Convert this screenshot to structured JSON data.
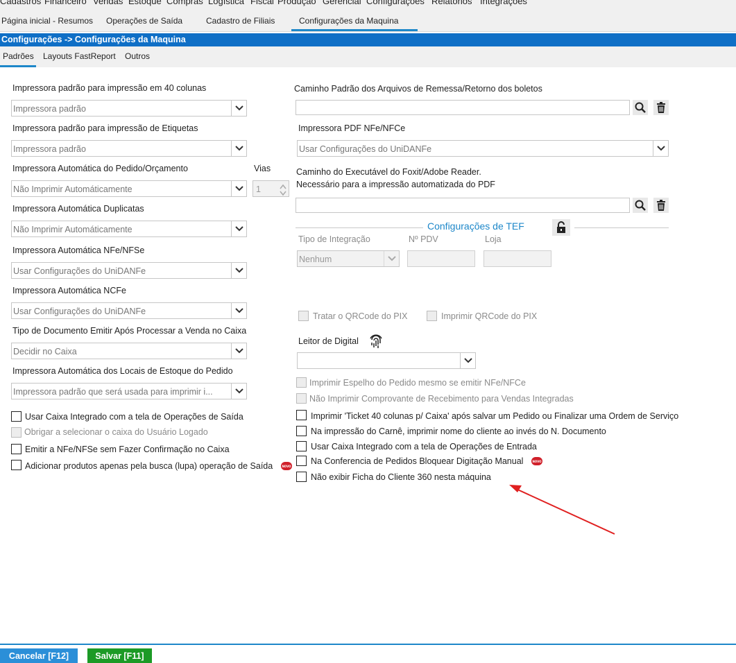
{
  "menu": [
    "Cadastros",
    "Financeiro",
    "Vendas",
    "Estoque",
    "Compras",
    "Logística",
    "Fiscal",
    "Produção",
    "Gerencial",
    "Configurações",
    "Relatórios",
    "Integrações"
  ],
  "tabs": [
    "Página inicial - Resumos",
    "Operações de Saída",
    "Cadastro de Filiais",
    "Configurações da Maquina"
  ],
  "breadcrumb": "Configurações -> Configurações da Maquina",
  "subtabs": [
    "Padrões",
    "Layouts FastReport",
    "Outros"
  ],
  "left": {
    "printer40_label": "Impressora padrão para impressão em 40 colunas",
    "printer40_value": "Impressora padrão",
    "labels_printer_label": "Impressora padrão para impressão de Etiquetas",
    "labels_printer_value": "Impressora padrão",
    "auto_order_label": "Impressora Automática do Pedido/Orçamento",
    "auto_order_value": "Não Imprimir Automáticamente",
    "copies_label": "Vias",
    "copies_value": "1",
    "auto_dup_label": "Impressora Automática Duplicatas",
    "auto_dup_value": "Não Imprimir Automáticamente",
    "auto_nfe_label": "Impressora Automática NFe/NFSe",
    "auto_nfe_value": "Usar Configurações do UniDANFe",
    "auto_ncfe_label": "Impressora Automática NCFe",
    "auto_ncfe_value": "Usar Configurações do UniDANFe",
    "doc_type_label": "Tipo de Documento Emitir Após Processar a Venda no Caixa",
    "doc_type_value": "Decidir no Caixa",
    "stock_print_label": "Impressora Automática dos Locais de Estoque do Pedido",
    "stock_print_value": "Impressora padrão que será usada para imprimir i...",
    "chk_integrated_cash": "Usar Caixa Integrado com a tela de Operações de Saída",
    "chk_force_user_cash": "Obrigar a selecionar o caixa do Usuário Logado",
    "chk_emit_nfe": "Emitir a NFe/NFSe sem Fazer Confirmação no Caixa",
    "chk_add_products": "Adicionar produtos apenas pela busca (lupa) operação de Saída"
  },
  "right": {
    "remessa_label": "Caminho Padrão dos Arquivos de Remessa/Retorno dos boletos",
    "pdf_printer_label": "Impressora PDF NFe/NFCe",
    "pdf_printer_value": "Usar Configurações do UniDANFe",
    "foxit_label_1": "Caminho do Executável do Foxit/Adobe Reader.",
    "foxit_label_2": "Necessário para a impressão automatizada do PDF",
    "tef_title": "Configurações de TEF",
    "tef_integration_label": "Tipo de Integração",
    "tef_integration_value": "Nenhum",
    "tef_pdv_label": "Nº PDV",
    "tef_store_label": "Loja",
    "chk_qrcode_pix": "Tratar o QRCode do PIX",
    "chk_print_qrcode": "Imprimir QRCode do PIX",
    "reader_label": "Leitor de Digital",
    "reader_value": "",
    "chk_mirror": "Imprimir Espelho do Pedido mesmo se emitir NFe/NFCe",
    "chk_no_receipt": "Não Imprimir Comprovante de Recebimento para Vendas Integradas",
    "chk_ticket40": "Imprimir 'Ticket 40 colunas p/ Caixa' após salvar um Pedido ou Finalizar uma Ordem de Serviço",
    "chk_carne_name": "Na impressão do Carnê, imprimir nome do cliente ao invés do N. Documento",
    "chk_integrated_entry": "Usar Caixa Integrado com a tela de Operações de Entrada",
    "chk_block_manual": "Na Conferencia de Pedidos Bloquear Digitação Manual",
    "chk_no_360": "Não exibir Ficha do Cliente 360 nesta máquina"
  },
  "badge_text": "NOVO",
  "footer": {
    "cancel": "Cancelar [F12]",
    "save": "Salvar [F11]"
  },
  "colors": {
    "accent": "#1d87c9",
    "titlebar": "#0f6fc6",
    "save": "#1c9a26",
    "cancel": "#2b8fd8",
    "arrow": "#e02020"
  }
}
